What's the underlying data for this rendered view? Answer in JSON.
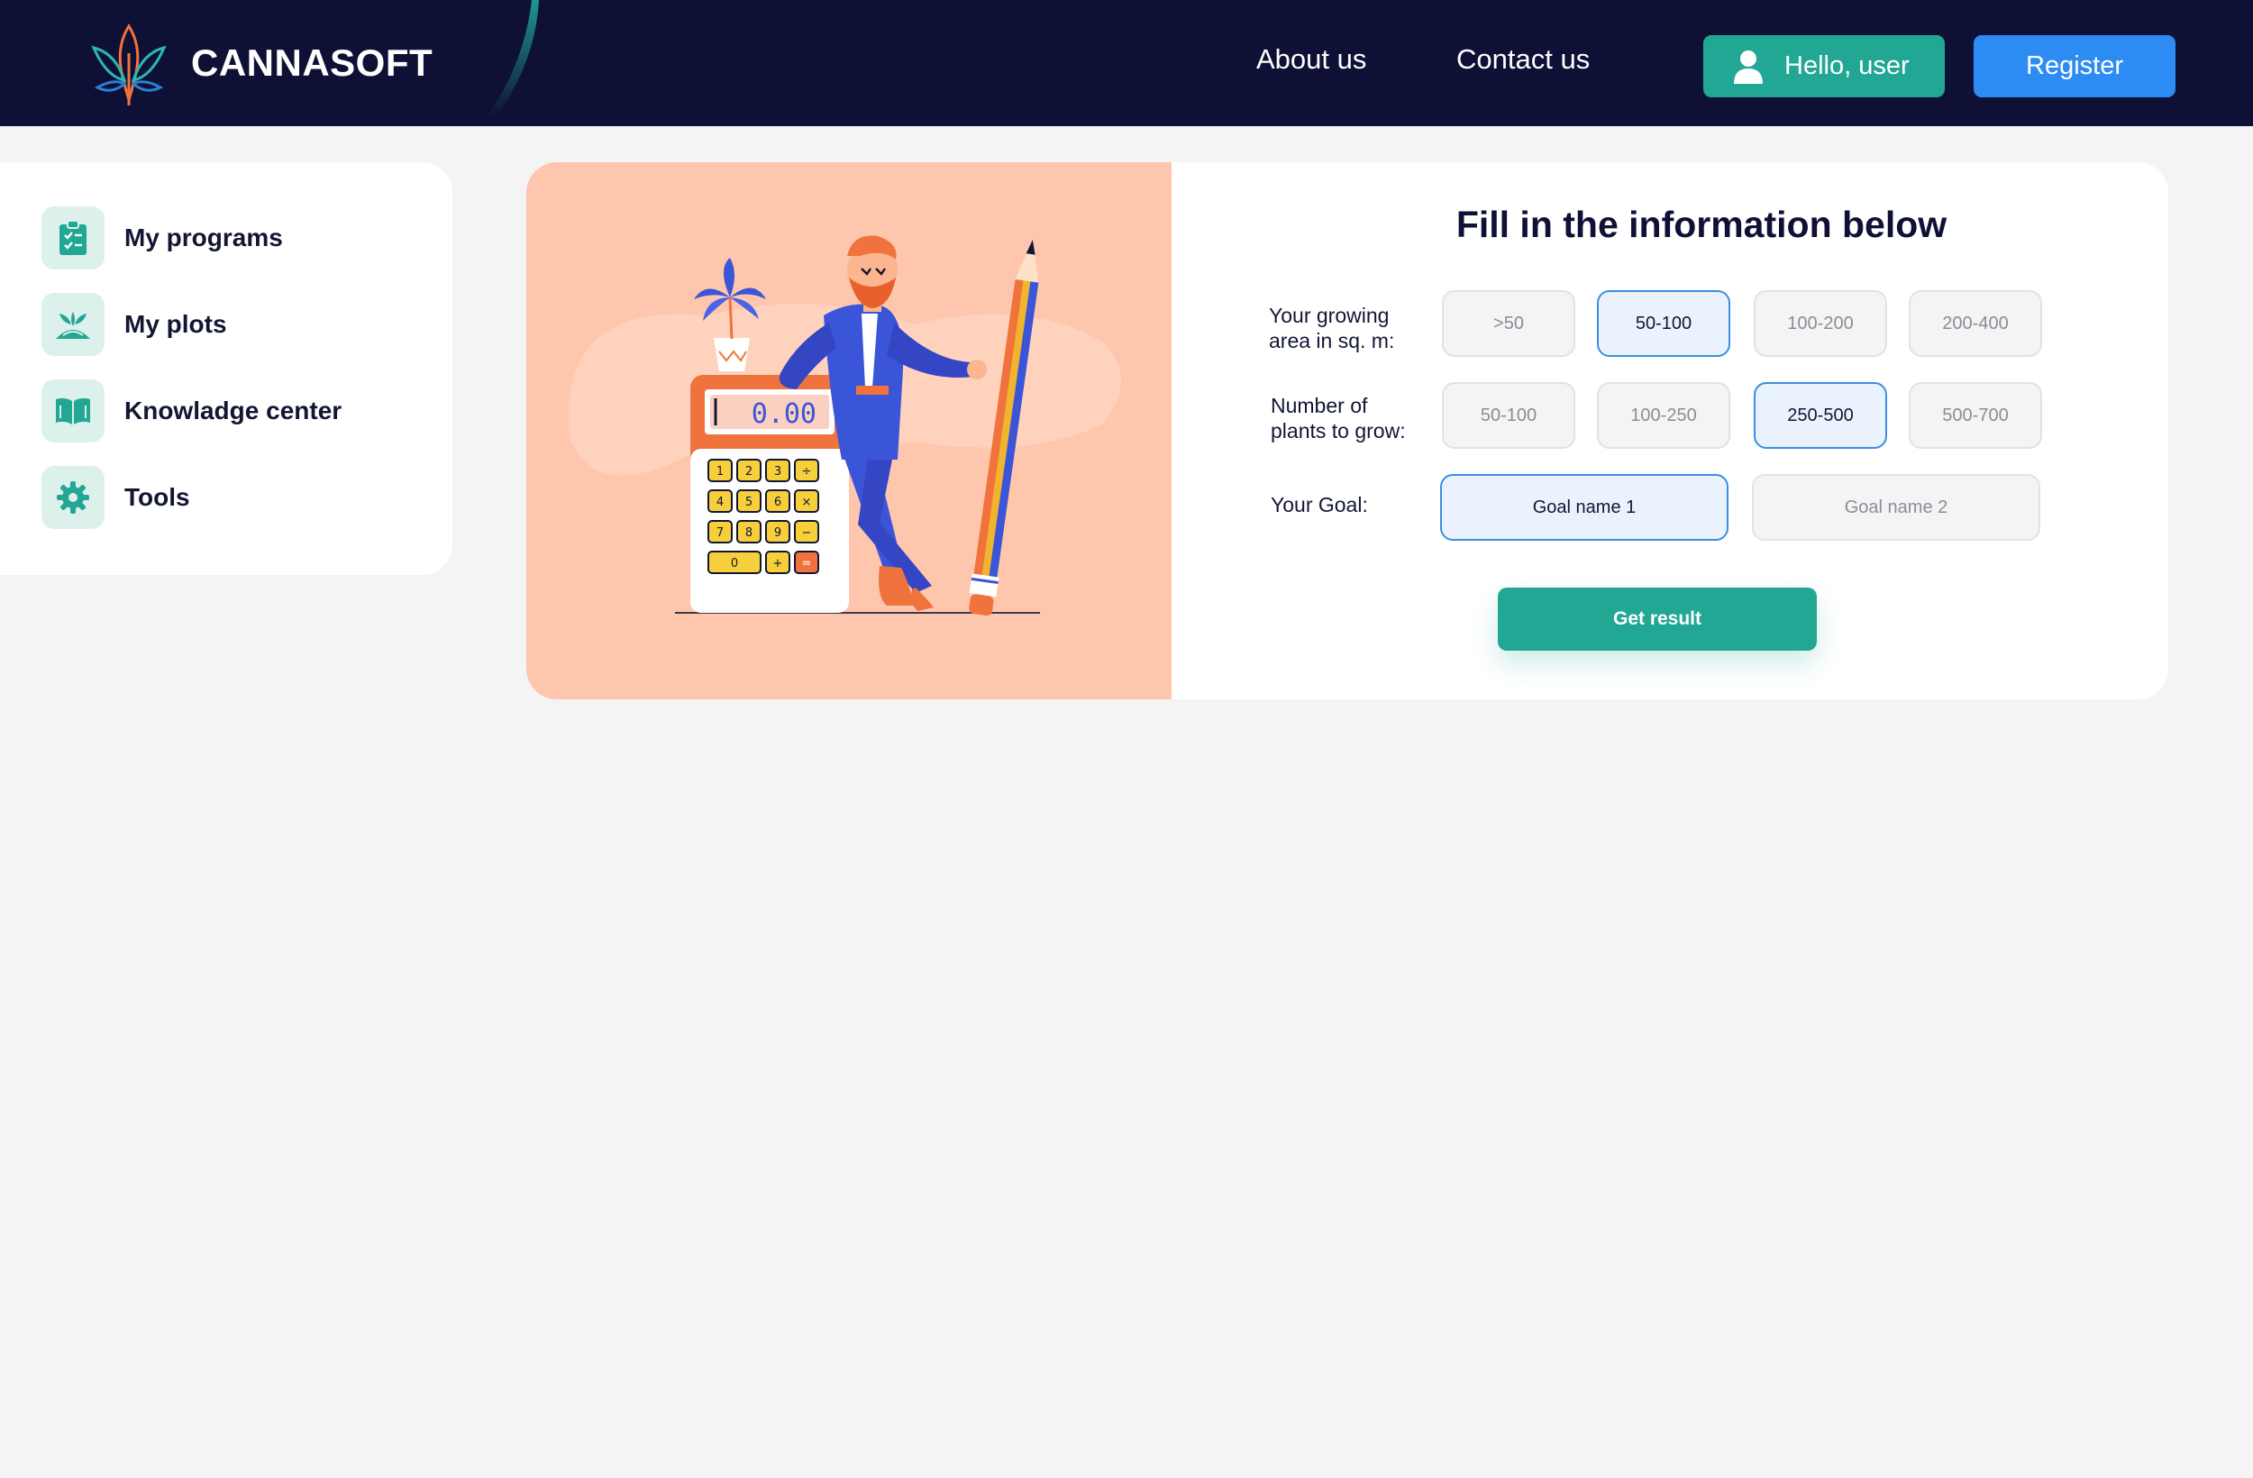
{
  "header": {
    "brand_name": "CANNASOFT",
    "nav": [
      {
        "label": "About us"
      },
      {
        "label": "Contact us"
      }
    ],
    "user_button_label": "Hello, user",
    "register_label": "Register"
  },
  "sidebar": {
    "items": [
      {
        "label": "My programs",
        "icon": "clipboard-checklist-icon"
      },
      {
        "label": "My plots",
        "icon": "plant-bed-icon"
      },
      {
        "label": "Knowladge center",
        "icon": "open-book-icon"
      },
      {
        "label": "Tools",
        "icon": "gear-icon"
      }
    ]
  },
  "illustration": {
    "calculator_display": "0.00",
    "calculator_keys": [
      "1",
      "2",
      "3",
      "÷",
      "4",
      "5",
      "6",
      "×",
      "7",
      "8",
      "9",
      "−",
      "0",
      "+",
      "="
    ]
  },
  "form": {
    "title": "Fill in the information below",
    "area": {
      "label_line1": "Your growing",
      "label_line2": "area in sq. m:",
      "options": [
        ">50",
        "50-100",
        "100-200",
        "200-400"
      ],
      "selected": "50-100"
    },
    "plants": {
      "label_line1": "Number of",
      "label_line2": "plants to grow:",
      "options": [
        "50-100",
        "100-250",
        "250-500",
        "500-700"
      ],
      "selected": "250-500"
    },
    "goal": {
      "label": "Your Goal:",
      "options": [
        "Goal name 1",
        "Goal name 2"
      ],
      "selected": "Goal name 1"
    },
    "submit_label": "Get result"
  },
  "colors": {
    "header_bg": "#0f1036",
    "accent_green": "#22a795",
    "accent_blue": "#2d8cf3",
    "illustration_bg": "#fec6ad",
    "selected_border": "#3b8ee4"
  }
}
